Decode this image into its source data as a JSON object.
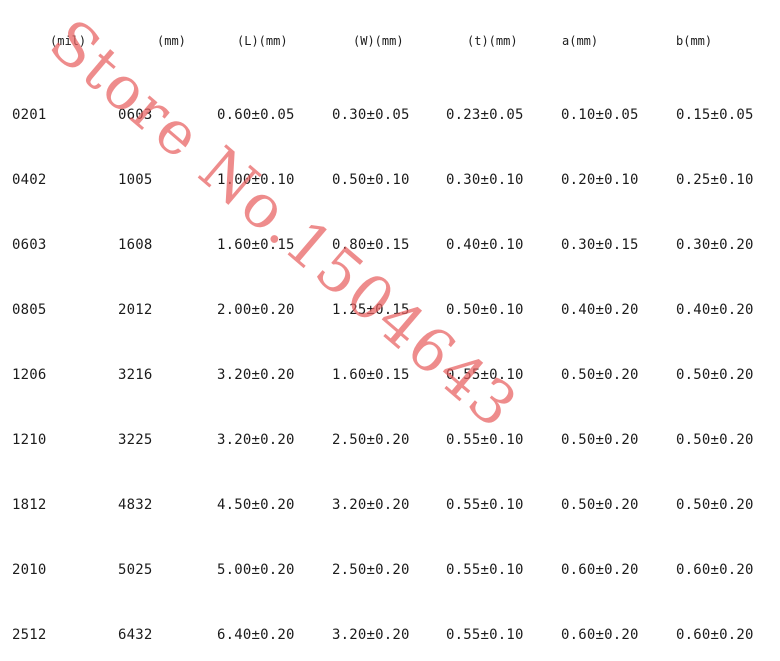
{
  "table": {
    "headers": [
      "(mil)",
      "(mm)",
      "(L)(mm)",
      "(W)(mm)",
      "(t)(mm)",
      "a(mm)",
      "b(mm)"
    ],
    "rows": [
      [
        "0201",
        "0603",
        "0.60±0.05",
        "0.30±0.05",
        "0.23±0.05",
        "0.10±0.05",
        "0.15±0.05"
      ],
      [
        "0402",
        "1005",
        "1.00±0.10",
        "0.50±0.10",
        "0.30±0.10",
        "0.20±0.10",
        "0.25±0.10"
      ],
      [
        "0603",
        "1608",
        "1.60±0.15",
        "0.80±0.15",
        "0.40±0.10",
        "0.30±0.15",
        "0.30±0.20"
      ],
      [
        "0805",
        "2012",
        "2.00±0.20",
        "1.25±0.15",
        "0.50±0.10",
        "0.40±0.20",
        "0.40±0.20"
      ],
      [
        "1206",
        "3216",
        "3.20±0.20",
        "1.60±0.15",
        "0.55±0.10",
        "0.50±0.20",
        "0.50±0.20"
      ],
      [
        "1210",
        "3225",
        "3.20±0.20",
        "2.50±0.20",
        "0.55±0.10",
        "0.50±0.20",
        "0.50±0.20"
      ],
      [
        "1812",
        "4832",
        "4.50±0.20",
        "3.20±0.20",
        "0.55±0.10",
        "0.50±0.20",
        "0.50±0.20"
      ],
      [
        "2010",
        "5025",
        "5.00±0.20",
        "2.50±0.20",
        "0.55±0.10",
        "0.60±0.20",
        "0.60±0.20"
      ],
      [
        "2512",
        "6432",
        "6.40±0.20",
        "3.20±0.20",
        "0.55±0.10",
        "0.60±0.20",
        "0.60±0.20"
      ]
    ]
  },
  "watermark": {
    "text": "Store No.1504643",
    "color": "#e85f5f"
  }
}
